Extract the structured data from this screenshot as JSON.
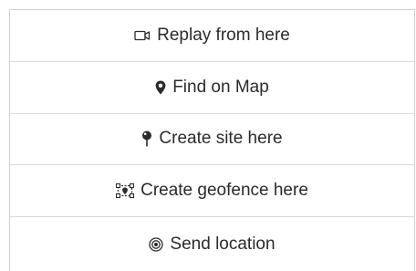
{
  "menu": {
    "items": [
      {
        "icon": "video-camera-icon",
        "label": "Replay from here"
      },
      {
        "icon": "map-marker-icon",
        "label": "Find on Map"
      },
      {
        "icon": "pushpin-icon",
        "label": "Create site here"
      },
      {
        "icon": "geofence-icon",
        "label": "Create geofence here"
      },
      {
        "icon": "target-icon",
        "label": "Send location"
      }
    ]
  }
}
